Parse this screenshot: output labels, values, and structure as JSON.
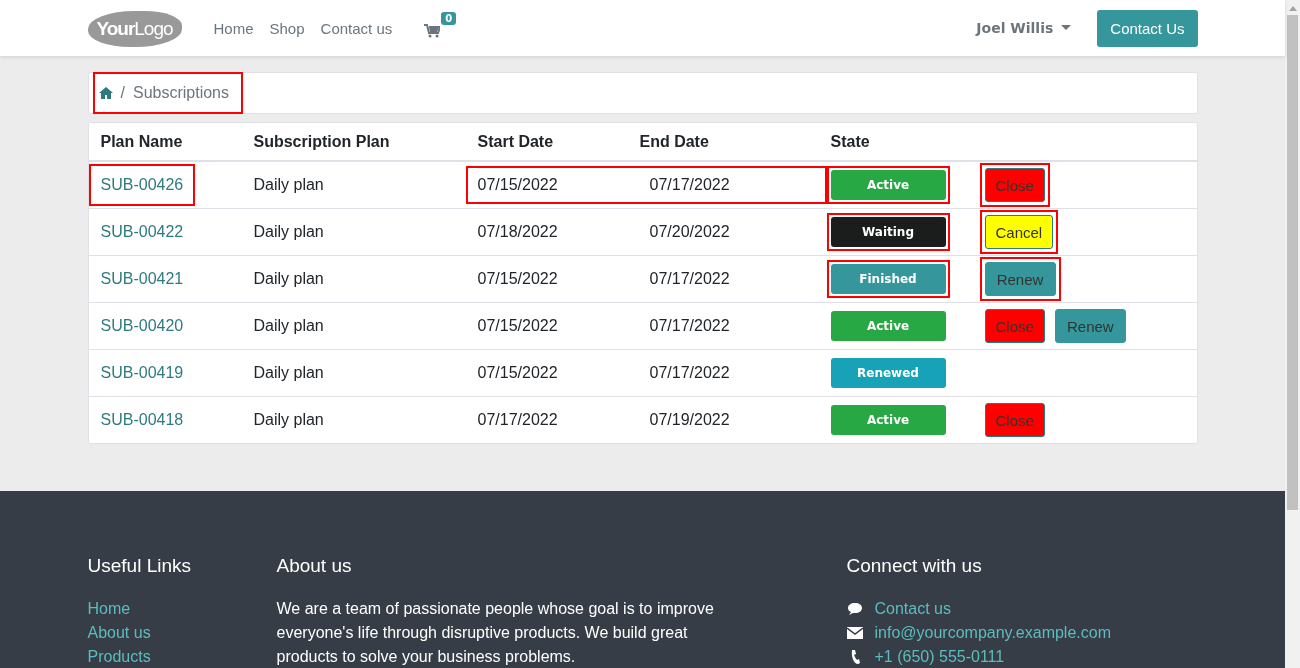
{
  "header": {
    "logo": {
      "word_1": "Your",
      "word_2": "Logo"
    },
    "nav": [
      "Home",
      "Shop",
      "Contact us"
    ],
    "cart_count": "0",
    "user": "Joel Willis",
    "contact_button": "Contact Us"
  },
  "breadcrumb": {
    "separator": "/",
    "current": "Subscriptions",
    "highlighted": true
  },
  "table": {
    "columns": [
      "Plan Name",
      "Subscription Plan",
      "Start Date",
      "End Date",
      "State"
    ],
    "rows": [
      {
        "plan_name": "SUB-00426",
        "plan": "Daily plan",
        "start": "07/15/2022",
        "end": "07/17/2022",
        "state": {
          "label": "Active",
          "kind": "active",
          "highlighted": true
        },
        "name_highlighted": true,
        "dates_highlighted": true,
        "actions": [
          {
            "label": "Close",
            "kind": "close",
            "highlighted": true
          }
        ]
      },
      {
        "plan_name": "SUB-00422",
        "plan": "Daily plan",
        "start": "07/18/2022",
        "end": "07/20/2022",
        "state": {
          "label": "Waiting",
          "kind": "waiting",
          "highlighted": true
        },
        "name_highlighted": false,
        "dates_highlighted": false,
        "actions": [
          {
            "label": "Cancel",
            "kind": "cancel",
            "highlighted": true
          }
        ]
      },
      {
        "plan_name": "SUB-00421",
        "plan": "Daily plan",
        "start": "07/15/2022",
        "end": "07/17/2022",
        "state": {
          "label": "Finished",
          "kind": "finished",
          "highlighted": true
        },
        "name_highlighted": false,
        "dates_highlighted": false,
        "actions": [
          {
            "label": "Renew",
            "kind": "renew",
            "highlighted": true
          }
        ]
      },
      {
        "plan_name": "SUB-00420",
        "plan": "Daily plan",
        "start": "07/15/2022",
        "end": "07/17/2022",
        "state": {
          "label": "Active",
          "kind": "active",
          "highlighted": false
        },
        "name_highlighted": false,
        "dates_highlighted": false,
        "actions": [
          {
            "label": "Close",
            "kind": "close",
            "highlighted": false
          },
          {
            "label": "Renew",
            "kind": "renew",
            "highlighted": false
          }
        ]
      },
      {
        "plan_name": "SUB-00419",
        "plan": "Daily plan",
        "start": "07/15/2022",
        "end": "07/17/2022",
        "state": {
          "label": "Renewed",
          "kind": "renewed",
          "highlighted": false
        },
        "name_highlighted": false,
        "dates_highlighted": false,
        "actions": []
      },
      {
        "plan_name": "SUB-00418",
        "plan": "Daily plan",
        "start": "07/17/2022",
        "end": "07/19/2022",
        "state": {
          "label": "Active",
          "kind": "active",
          "highlighted": false
        },
        "name_highlighted": false,
        "dates_highlighted": false,
        "actions": [
          {
            "label": "Close",
            "kind": "close",
            "highlighted": false
          }
        ]
      }
    ]
  },
  "footer": {
    "links_title": "Useful Links",
    "links": [
      "Home",
      "About us",
      "Products"
    ],
    "about_title": "About us",
    "about_text": "We are a team of passionate people whose goal is to improve everyone's life through disruptive products. We build great products to solve your business problems.",
    "connect_title": "Connect with us",
    "connect": [
      {
        "kind": "chat",
        "text": "Contact us"
      },
      {
        "kind": "mail",
        "text": "info@yourcompany.example.com"
      },
      {
        "kind": "phone",
        "text": "+1 (650) 555-0111"
      }
    ]
  }
}
